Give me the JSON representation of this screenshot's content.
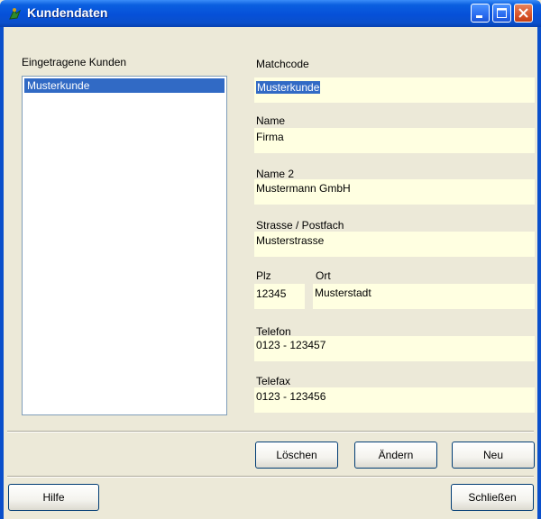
{
  "window": {
    "title": "Kundendaten"
  },
  "customers": {
    "label": "Eingetragene Kunden",
    "items": [
      "Musterkunde"
    ]
  },
  "fields": {
    "matchcode": {
      "label": "Matchcode",
      "value": "Musterkunde"
    },
    "name": {
      "label": "Name",
      "value": "Firma"
    },
    "name2": {
      "label": "Name 2",
      "value": "Mustermann GmbH"
    },
    "strasse": {
      "label": "Strasse / Postfach",
      "value": "Musterstrasse"
    },
    "plz": {
      "label": "Plz",
      "value": "12345"
    },
    "ort": {
      "label": "Ort",
      "value": "Musterstadt"
    },
    "telefon": {
      "label": "Telefon",
      "value": "0123 - 123457"
    },
    "telefax": {
      "label": "Telefax",
      "value": "0123 - 123456"
    }
  },
  "buttons": {
    "loeschen": "Löschen",
    "aendern": "Ändern",
    "neu": "Neu",
    "hilfe": "Hilfe",
    "schliessen": "Schließen"
  },
  "colors": {
    "field_bg": "#ffffe1",
    "selection": "#316ac5",
    "titlebar": "#0a5fe0"
  }
}
